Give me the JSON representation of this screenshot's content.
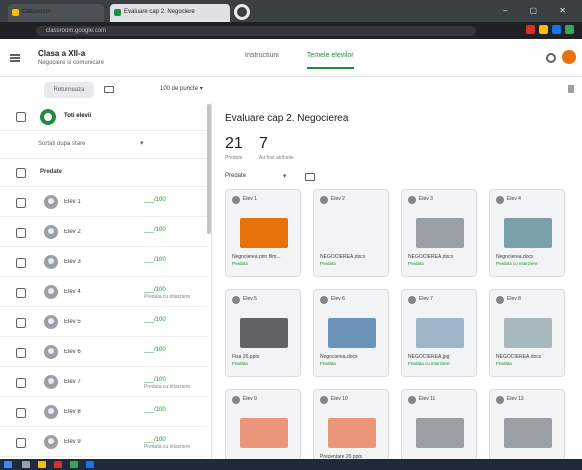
{
  "browser": {
    "tabs": [
      {
        "label": "Classroom"
      },
      {
        "label": "Evaluare cap 2. Negociere"
      }
    ],
    "url": "classroom.google.com"
  },
  "header": {
    "class_title": "Clasa a XII-a",
    "class_subtitle": "Negociere si comunicare",
    "tabs": [
      "Instructiuni",
      "Temele elevilor"
    ],
    "active_tab": "Temele elevilor"
  },
  "toolbar": {
    "return_label": "Returneaza",
    "points_label": "100 de puncte"
  },
  "left": {
    "all_students_label": "Toti elevii",
    "sort_label": "Sortati dupa stare",
    "section_label": "Predate",
    "students": [
      {
        "name": "Elev 1",
        "grade": "___/100",
        "note": ""
      },
      {
        "name": "Elev 2",
        "grade": "___/100",
        "note": ""
      },
      {
        "name": "Elev 3",
        "grade": "___/100",
        "note": ""
      },
      {
        "name": "Elev 4",
        "grade": "___/100",
        "note": "Predata cu intarziere"
      },
      {
        "name": "Elev 5",
        "grade": "___/100",
        "note": ""
      },
      {
        "name": "Elev 6",
        "grade": "___/100",
        "note": ""
      },
      {
        "name": "Elev 7",
        "grade": "___/100",
        "note": "Predata cu intarziere"
      },
      {
        "name": "Elev 8",
        "grade": "___/100",
        "note": ""
      },
      {
        "name": "Elev 9",
        "grade": "___/100",
        "note": "Predata cu intarziere"
      }
    ]
  },
  "main": {
    "assignment_title": "Evaluare cap 2. Negocierea",
    "stats": [
      {
        "value": "21",
        "label": "Predate"
      },
      {
        "value": "7",
        "label": "Au fost atribuite"
      }
    ],
    "filter_label": "Predate",
    "cards": [
      {
        "name": "Elev 1",
        "file": "Negocierea prin film...",
        "status": "Predata",
        "thumb_color": "#e8710a"
      },
      {
        "name": "Elev 2",
        "file": "NEGOCIEREA.docx",
        "status": "Predata",
        "thumb_color": "#f1f3f4"
      },
      {
        "name": "Elev 3",
        "file": "NEGOCIEREA.docx",
        "status": "Predata",
        "thumb_color": "#9aa0a6"
      },
      {
        "name": "Elev 4",
        "file": "Negocierea.docx",
        "status": "Predata cu intarziere",
        "thumb_color": "#7aa2a8"
      },
      {
        "name": "Elev 5",
        "file": "Fisa 20.pptx",
        "status": "Predata",
        "thumb_color": "#5f6368"
      },
      {
        "name": "Elev 6",
        "file": "Negocierea.docx",
        "status": "Predata",
        "thumb_color": "#6b93b8"
      },
      {
        "name": "Elev 7",
        "file": "NEGOCIEREA.jpg",
        "status": "Predata cu intarziere",
        "thumb_color": "#9fb6c8"
      },
      {
        "name": "Elev 8",
        "file": "NEGOCIEREA.docx",
        "status": "Predata",
        "thumb_color": "#a8b8bf"
      },
      {
        "name": "Elev 9",
        "file": "",
        "status": "",
        "thumb_color": "#e9967a"
      },
      {
        "name": "Elev 10",
        "file": "Prezentare 20.pptx",
        "status": "",
        "thumb_color": "#e9967a"
      },
      {
        "name": "Elev 11",
        "file": "",
        "status": "",
        "thumb_color": "#9aa0a6"
      },
      {
        "name": "Elev 12",
        "file": "",
        "status": "",
        "thumb_color": "#9aa0a6"
      }
    ]
  },
  "colors": {
    "accent": "#1e8e3e",
    "avatar": "#e8710a"
  }
}
